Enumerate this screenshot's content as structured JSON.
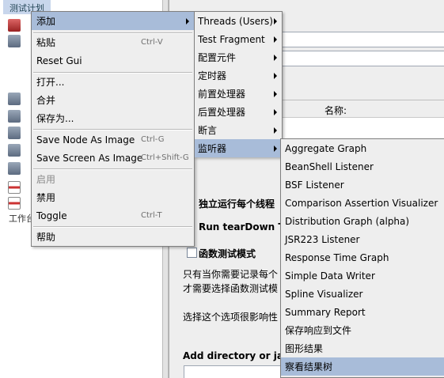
{
  "tree": {
    "root_label": "测试计划",
    "bottom_label": "工作台"
  },
  "background": {
    "name_label": "名称:",
    "run_each_label": "独立运行每个线程",
    "run_teardown_label": "Run tearDown Thr",
    "functional_mode_label": "函数测试模式",
    "desc_line1": "只有当你需要记录每个",
    "desc_line2": "才需要选择函数测试模",
    "desc_line3": "选择这个选项很影响性",
    "add_dir_label": "Add directory or jar to"
  },
  "menu_main": {
    "items": [
      {
        "label": "添加",
        "accel": "",
        "submenu": true,
        "selected": true
      },
      {
        "label": "粘贴",
        "accel": "Ctrl-V"
      },
      {
        "label": "Reset Gui",
        "accel": ""
      },
      {
        "label": "打开...",
        "accel": ""
      },
      {
        "label": "合并",
        "accel": ""
      },
      {
        "label": "保存为...",
        "accel": ""
      },
      {
        "label": "Save Node As Image",
        "accel": "Ctrl-G"
      },
      {
        "label": "Save Screen As Image",
        "accel": "Ctrl+Shift-G"
      },
      {
        "label": "启用",
        "accel": "",
        "disabled": true
      },
      {
        "label": "禁用",
        "accel": ""
      },
      {
        "label": "Toggle",
        "accel": "Ctrl-T"
      },
      {
        "label": "帮助",
        "accel": ""
      }
    ]
  },
  "menu_add": {
    "items": [
      {
        "label": "Threads (Users)"
      },
      {
        "label": "Test Fragment"
      },
      {
        "label": "配置元件"
      },
      {
        "label": "定时器"
      },
      {
        "label": "前置处理器"
      },
      {
        "label": "后置处理器"
      },
      {
        "label": "断言"
      },
      {
        "label": "监听器",
        "selected": true
      }
    ]
  },
  "menu_listener": {
    "items": [
      {
        "label": "Aggregate Graph"
      },
      {
        "label": "BeanShell Listener"
      },
      {
        "label": "BSF Listener"
      },
      {
        "label": "Comparison Assertion Visualizer"
      },
      {
        "label": "Distribution Graph (alpha)"
      },
      {
        "label": "JSR223 Listener"
      },
      {
        "label": "Response Time Graph"
      },
      {
        "label": "Simple Data Writer"
      },
      {
        "label": "Spline Visualizer"
      },
      {
        "label": "Summary Report"
      },
      {
        "label": "保存响应到文件"
      },
      {
        "label": "图形结果"
      },
      {
        "label": "察看结果树",
        "selected": true
      }
    ]
  },
  "colors": {
    "menu_bg": "#eeeeee",
    "selection": "#a8bcd9",
    "tree_selection": "#c8d6ec"
  }
}
